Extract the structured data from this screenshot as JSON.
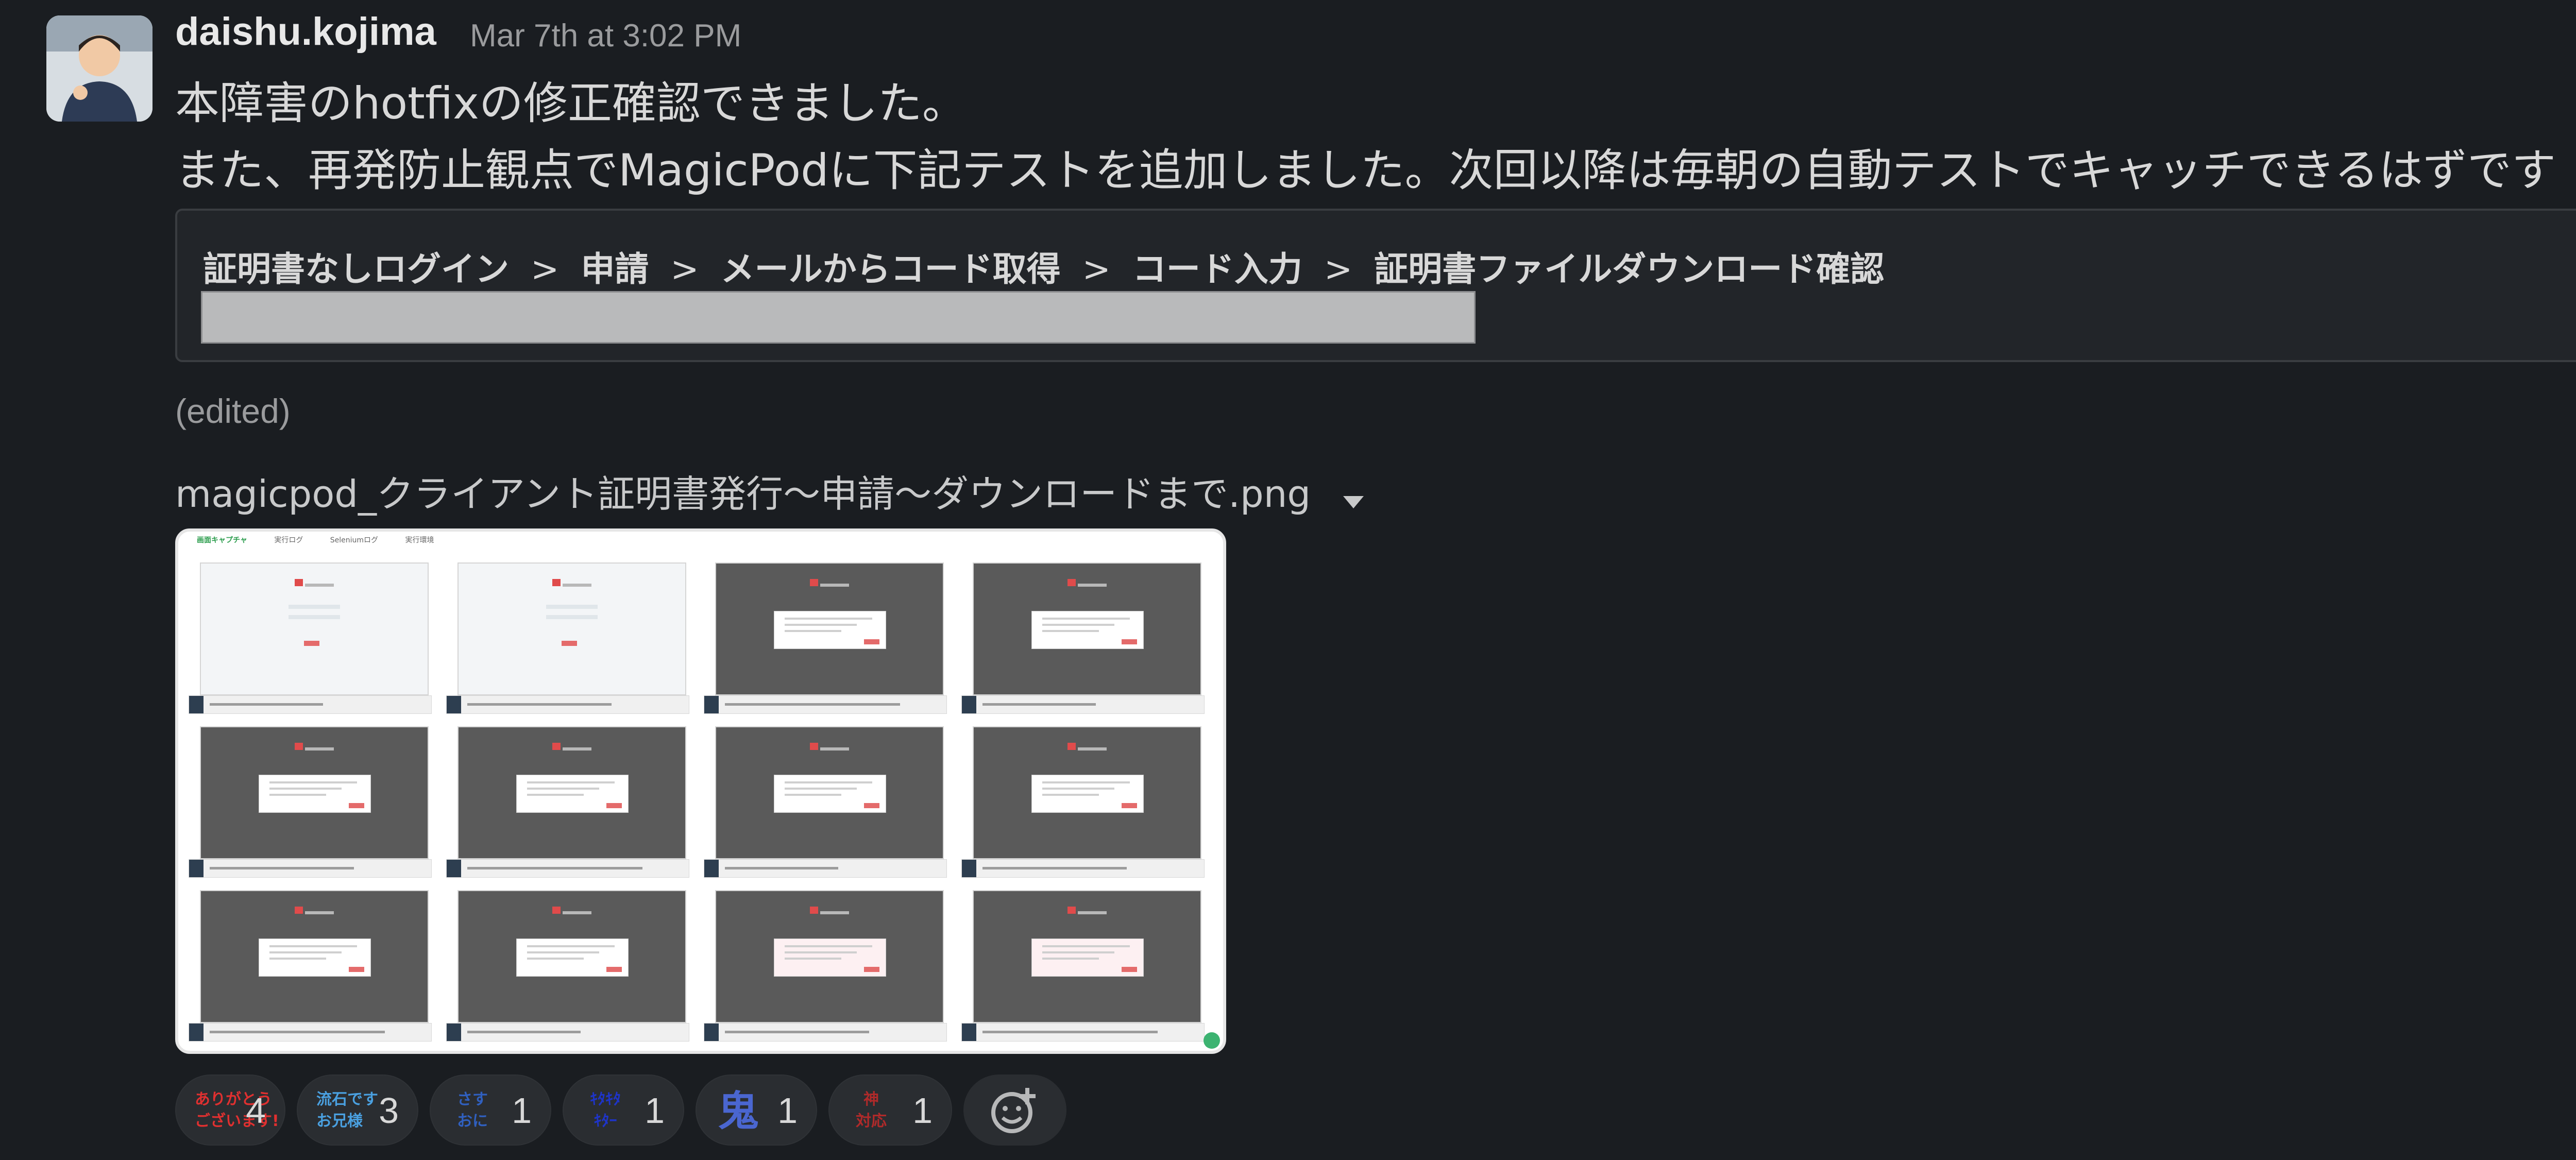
{
  "message": {
    "author": "daishu.kojima",
    "timestamp": "Mar 7th at 3:02 PM",
    "line1": "本障害のhotfixの修正確認できました。",
    "line2": "また、再発防止観点でMagicPodに下記テストを追加しました。次回以降は毎朝の自動テストでキャッチできるはずです",
    "emoji_after_line2": "bowing-person-icon",
    "edited_label": "(edited)"
  },
  "quote": {
    "breadcrumb": [
      "証明書なしログイン",
      "申請",
      "メールからコード取得",
      "コード入力",
      "証明書ファイルダウンロード確認"
    ],
    "separator": ">"
  },
  "attachment": {
    "filename": "magicpod_クライアント証明書発行〜申請〜ダウンロードまで.png",
    "tabs": [
      "画面キャプチャ",
      "実行ログ",
      "Seleniumログ",
      "実行環境"
    ]
  },
  "reactions": [
    {
      "name": "arigatou-gozaimasu",
      "emoji_text": "ありがとう\nございます!",
      "count": "4",
      "color": "#e03030"
    },
    {
      "name": "sasuga-desu-oniisama",
      "emoji_text": "流石です\nお兄様",
      "count": "3",
      "color": "#4aa0e0"
    },
    {
      "name": "sasu-oni",
      "emoji_text": "さす\nおに",
      "count": "1",
      "color": "#3060c0"
    },
    {
      "name": "blue-emoji",
      "emoji_text": "ｷﾀｷﾀ\nｷﾀｰ",
      "count": "1",
      "color": "#1e34c8"
    },
    {
      "name": "oni",
      "emoji_text": "鬼",
      "count": "1",
      "color": "#4a66d0"
    },
    {
      "name": "kami-taiou",
      "emoji_text": "神\n対応",
      "count": "1",
      "color": "#b02a2a"
    }
  ],
  "colors": {
    "background": "#1a1d21",
    "text": "#d1d2d3",
    "muted": "#9a9b9d",
    "reaction_bg": "#2a2d31"
  }
}
